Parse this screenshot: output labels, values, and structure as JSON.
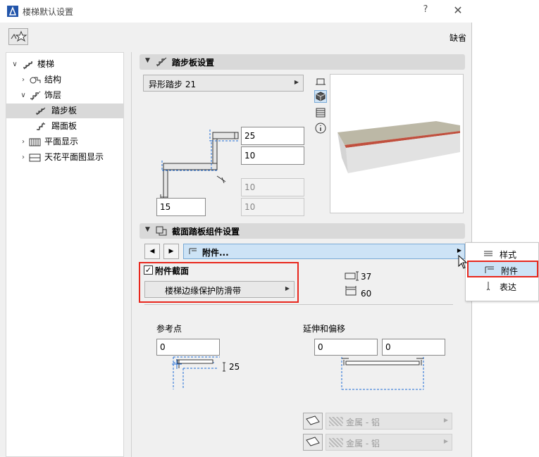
{
  "window": {
    "title": "楼梯默认设置",
    "help": "?",
    "close": "✕",
    "default_label": "缺省"
  },
  "tree": {
    "items": [
      {
        "label": "楼梯",
        "chev": "∨",
        "icon": "stair-icon"
      },
      {
        "label": "结构",
        "chev": "›",
        "icon": "structure-icon"
      },
      {
        "label": "饰层",
        "chev": "∨",
        "icon": "finish-icon"
      },
      {
        "label": "踏步板",
        "chev": "",
        "icon": "tread-icon"
      },
      {
        "label": "踢面板",
        "chev": "",
        "icon": "riser-icon"
      },
      {
        "label": "平面显示",
        "chev": "›",
        "icon": "floor-plan-icon"
      },
      {
        "label": "天花平面图显示",
        "chev": "›",
        "icon": "ceiling-plan-icon"
      }
    ]
  },
  "tread_section": {
    "title": "踏步板设置",
    "profile_dropdown": "异形踏步 21",
    "fields": {
      "thickness": "25",
      "nosing": "10",
      "disabled1": "10",
      "disabled2": "10",
      "overhang": "15"
    }
  },
  "component_section": {
    "title": "截面踏板组件设置",
    "nav_prev": "◀",
    "nav_next": "▶",
    "attach_label": "附件...",
    "checkbox_checked": true,
    "checkbox_mark": "✓",
    "checkbox_label": "附件截面",
    "profile_dropdown": "楼梯边缘保护防滑带",
    "height_value": "37",
    "width_value": "60",
    "ref_point_label": "参考点",
    "ref_point_value": "0",
    "ref_dim_value": "25",
    "extend_label": "延伸和偏移",
    "extend_value1": "0",
    "extend_value2": "0",
    "material1": "金属 - 铝",
    "material2": "金属 - 铝"
  },
  "popup": {
    "items": [
      {
        "label": "样式",
        "icon": "style-icon"
      },
      {
        "label": "附件",
        "icon": "attachment-icon"
      },
      {
        "label": "表达",
        "icon": "representation-icon"
      }
    ]
  },
  "colors": {
    "highlight_red": "#e8271d",
    "selection_blue": "#cde3f6",
    "dim_blue": "#1e6bd6"
  }
}
